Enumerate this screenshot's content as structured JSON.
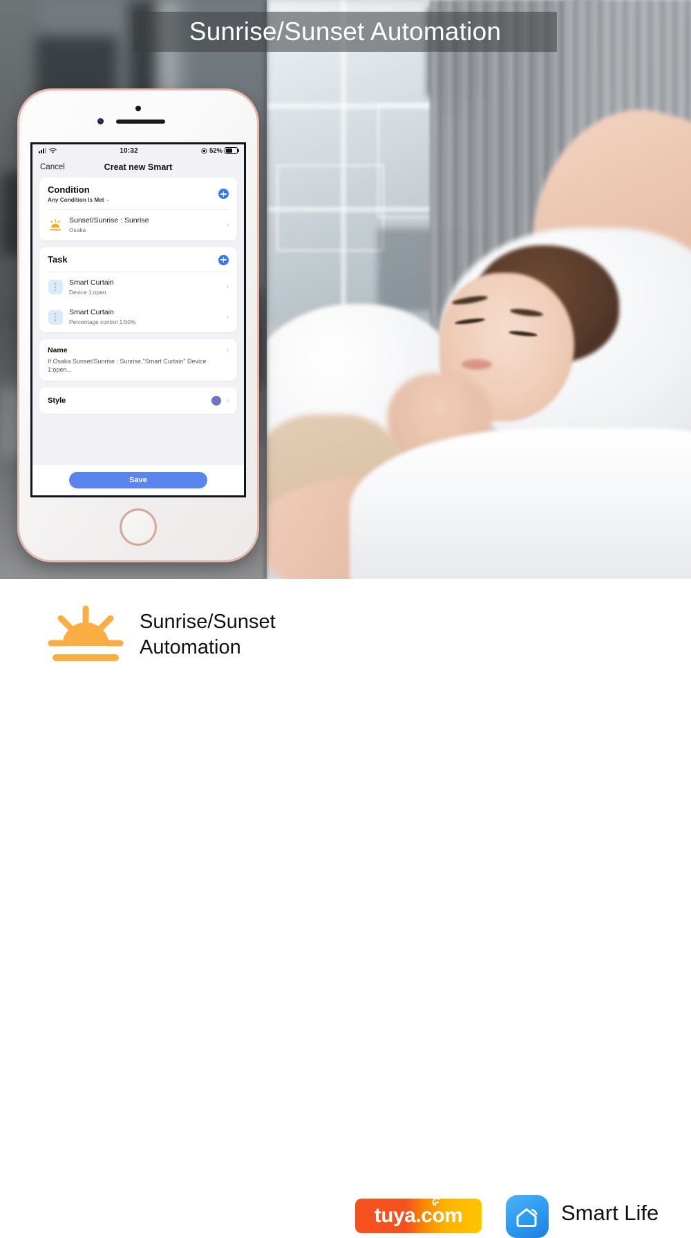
{
  "banner": {
    "title": "Sunrise/Sunset Automation"
  },
  "phone": {
    "status_bar": {
      "time": "10:32",
      "battery_percent": "52%",
      "signal_icon": "signal-bars-icon",
      "wifi_icon": "wifi-icon",
      "rotation_lock_icon": "rotation-lock-icon",
      "battery_icon": "battery-icon"
    },
    "nav": {
      "cancel": "Cancel",
      "title": "Creat new Smart"
    },
    "condition_card": {
      "title": "Condition",
      "subtitle": "Any Condition Is Met",
      "caret_icon": "chevron-down-icon",
      "add_icon": "plus-circle-icon",
      "items": [
        {
          "icon": "sunrise-icon",
          "title": "Sunset/Sunrise : Sunrise",
          "subtitle": "Osaka",
          "chevron": "›"
        }
      ]
    },
    "task_card": {
      "title": "Task",
      "add_icon": "plus-circle-icon",
      "items": [
        {
          "icon": "smart-curtain-icon",
          "title": "Smart Curtain",
          "subtitle": "Device 1:open",
          "chevron": "›"
        },
        {
          "icon": "smart-curtain-icon",
          "title": "Smart Curtain",
          "subtitle": "Percentage control 1:50%",
          "chevron": "›"
        }
      ]
    },
    "name_card": {
      "title": "Name",
      "value": "If Osaka Sunset/Sunrise : Sunrise,\"Smart Curtain\" Device 1:open...",
      "chevron": "›"
    },
    "style_card": {
      "label": "Style",
      "swatch_color": "#6f74c9",
      "chevron": "›"
    },
    "save_button": {
      "label": "Save",
      "color": "#5b85ee"
    }
  },
  "footer": {
    "feature_icon": "sunrise-icon",
    "feature_title_line1": "Sunrise/Sunset",
    "feature_title_line2": "Automation",
    "tuya_logo_text": "tuya.com",
    "smart_life_icon": "smart-home-app-icon",
    "smart_life_text": "Smart Life"
  },
  "colors": {
    "accent_blue": "#3b78e7",
    "save_blue": "#5b85ee",
    "sun_orange": "#f9ad42",
    "tuya_orange": "#f4511e",
    "tuya_yellow": "#fdc500"
  }
}
